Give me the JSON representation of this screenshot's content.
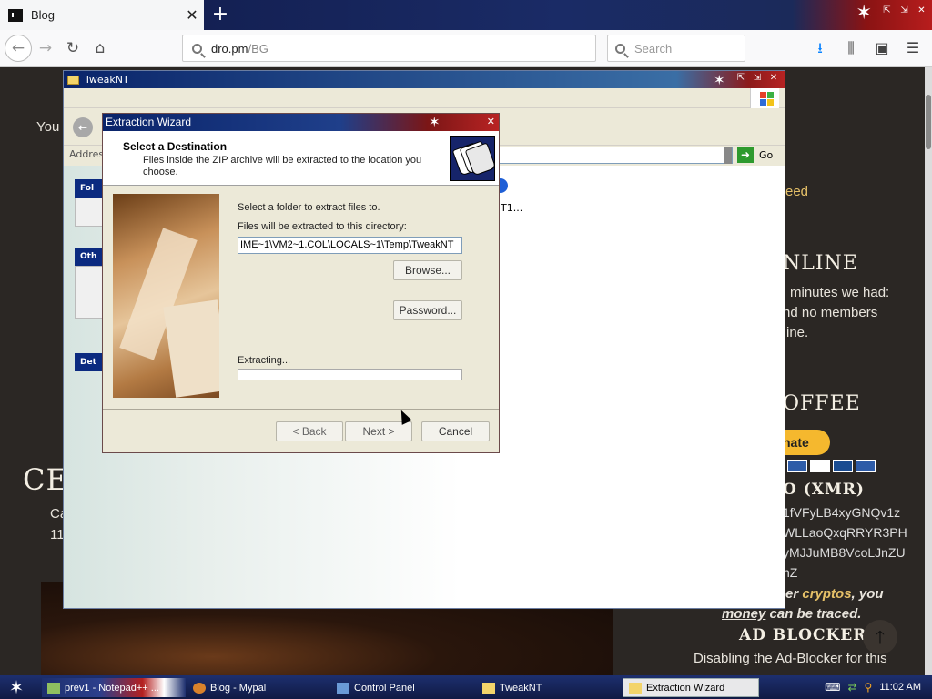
{
  "browser": {
    "tab_title": "Blog",
    "tab_close": "✕",
    "new_tab": "+",
    "url_host": "dro.pm",
    "url_path": "/BG",
    "search_placeholder": "Search",
    "win_controls": [
      "⇱",
      "⇲",
      "✕"
    ]
  },
  "webpage": {
    "text_you": "You",
    "text_feed": "eed",
    "online_heading": "NLINE",
    "online_line1": "minutes we had:",
    "online_line2": "nd no members",
    "online_line3": "ine.",
    "coffee_heading": "OFFEE",
    "paypal_label": "nate",
    "xmr_heading": "O (XMR)",
    "xmr_lines": [
      "1fVFyLB4xyGNQv1z",
      "WLLaoQxqRRYR3PH",
      "yMJJuMB8VcoLJnZU",
      "nZ"
    ],
    "privacy_line1_pre": "er ",
    "privacy_line1_em": "cryptos",
    "privacy_line1_post": ", you",
    "privacy_line2_em": "money",
    "privacy_line2_post": " can be traced.",
    "adblock_heading": "AD BLOCKER",
    "adblock_line": "Disabling the Ad-Blocker for this",
    "left_heading": "CEL",
    "left_meta1": "Ca",
    "left_meta2": "11"
  },
  "explorer": {
    "title": "TweakNT",
    "address_label": "Address",
    "go_label": "Go",
    "content_text": "T1...",
    "sidebox_labels": [
      "Fol",
      "Oth",
      "Det"
    ]
  },
  "wizard": {
    "title": "Extraction Wizard",
    "close": "✕",
    "heading": "Select a Destination",
    "subheading": "Files inside the ZIP archive will be extracted to the location you choose.",
    "select_folder_label": "Select a folder to extract files to.",
    "directory_label": "Files will be extracted to this directory:",
    "directory_value": "IME~1\\VM2~1.COL\\LOCALS~1\\Temp\\TweakNT",
    "browse_button": "Browse...",
    "password_button": "Password...",
    "status_label": "Extracting...",
    "progress": 0,
    "back_button": "< Back",
    "next_button": "Next >",
    "cancel_button": "Cancel"
  },
  "taskbar": {
    "items": [
      "prev1 - Notepad++ ...",
      "Blog - Mypal",
      "Control Panel",
      "TweakNT",
      "Extraction Wizard"
    ],
    "clock": "11:02 AM"
  }
}
